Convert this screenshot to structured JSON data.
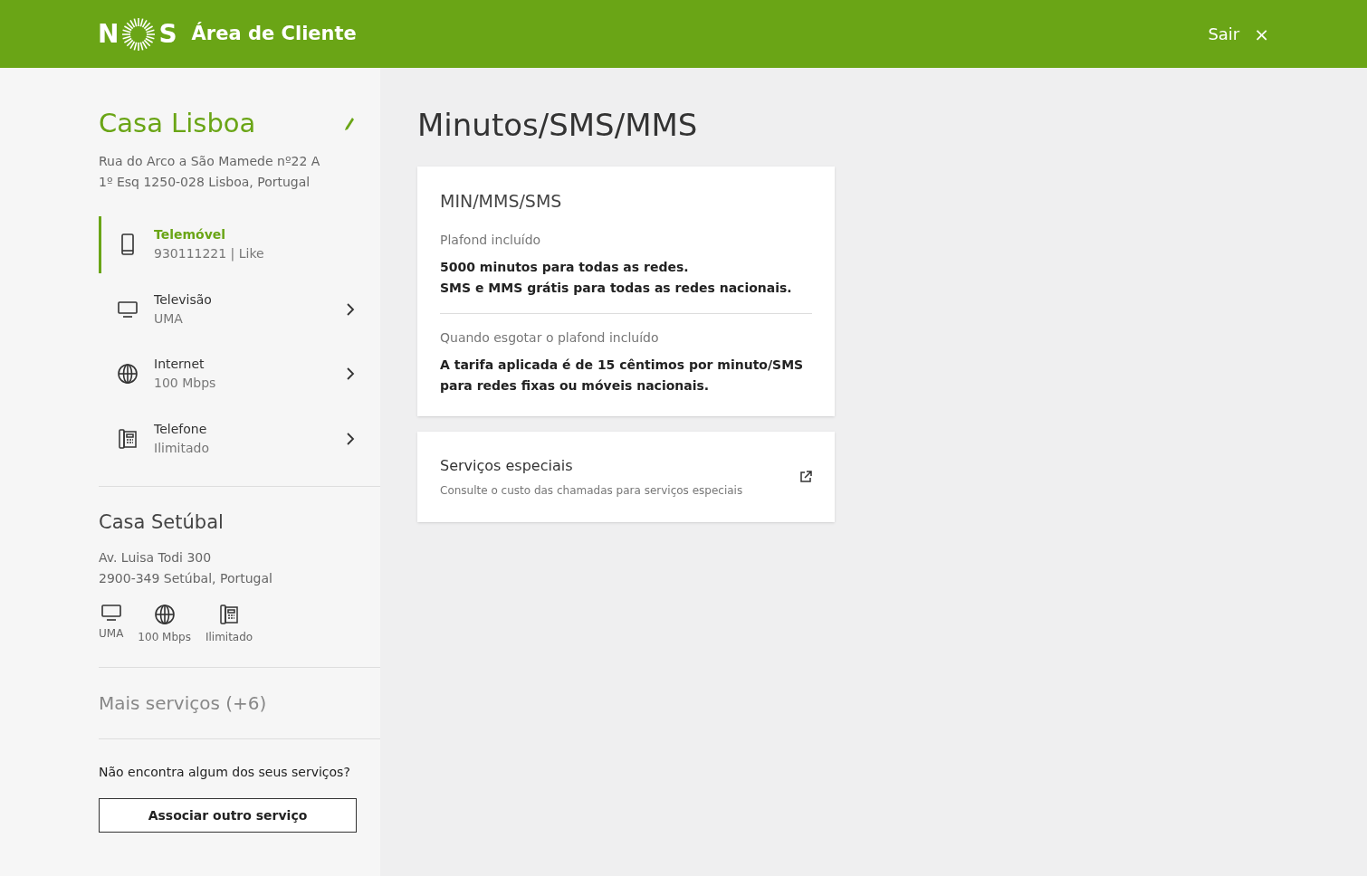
{
  "header": {
    "logo_letters": [
      "N",
      "S"
    ],
    "title": "Área de Cliente",
    "logout": "Sair",
    "close": "×"
  },
  "sidebar": {
    "primary_location": {
      "name": "Casa Lisboa",
      "address_lines": [
        "Rua do Arco a São Mamede nº22 A",
        "1º Esq 1250-028 Lisboa, Portugal"
      ],
      "services": [
        {
          "kind": "mobile",
          "name": "Telemóvel",
          "detail": "930111221 | Like",
          "selected": true
        },
        {
          "kind": "tv",
          "name": "Televisão",
          "detail": "UMA",
          "selected": false
        },
        {
          "kind": "internet",
          "name": "Internet",
          "detail": "100 Mbps",
          "selected": false
        },
        {
          "kind": "phone",
          "name": "Telefone",
          "detail": "Ilimitado",
          "selected": false
        }
      ]
    },
    "secondary_location": {
      "name": "Casa Setúbal",
      "address_lines": [
        "Av. Luisa Todi 300",
        "2900-349 Setúbal, Portugal"
      ],
      "services": [
        {
          "kind": "tv",
          "label": "UMA"
        },
        {
          "kind": "internet",
          "label": "100 Mbps"
        },
        {
          "kind": "phone",
          "label": "Ilimitado"
        }
      ]
    },
    "more_services": "Mais serviços (+6)",
    "missing_prompt": "Não encontra algum dos seus serviços?",
    "associate_button": "Associar outro serviço"
  },
  "main": {
    "title": "Minutos/SMS/MMS",
    "plan_card": {
      "title": "MIN/MMS/SMS",
      "sections": [
        {
          "label": "Plafond incluído",
          "lines": [
            "5000 minutos para todas as redes.",
            "SMS e MMS grátis para todas as redes nacionais."
          ]
        },
        {
          "label": "Quando esgotar o plafond incluído",
          "lines": [
            "A tarifa aplicada é de 15 cêntimos por minuto/SMS para redes fixas ou móveis nacionais."
          ]
        }
      ]
    },
    "special_card": {
      "title": "Serviços especiais",
      "description": "Consulte o custo das chamadas para serviços especiais"
    }
  }
}
